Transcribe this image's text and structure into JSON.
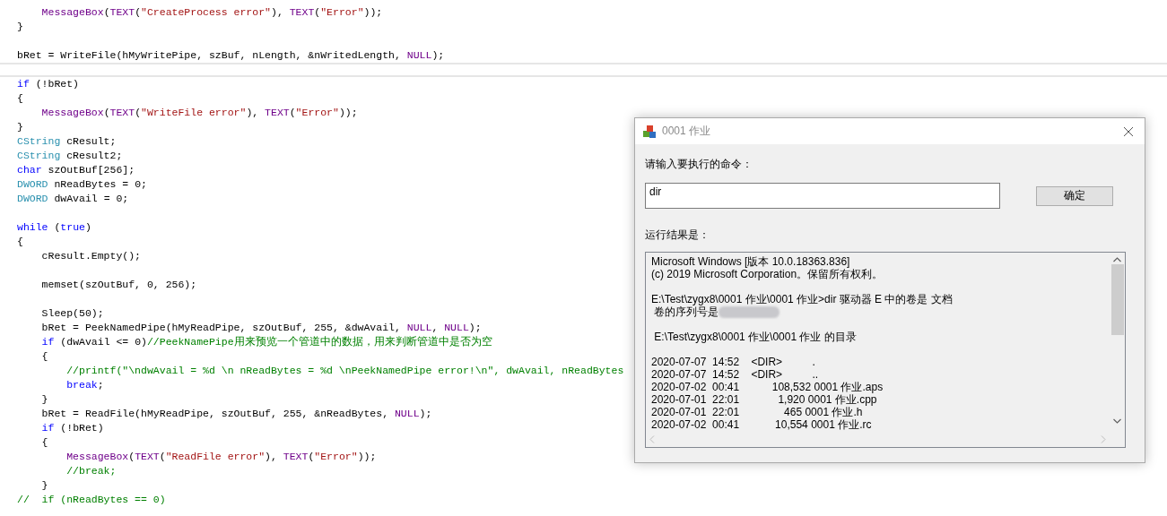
{
  "editor": {
    "lines": [
      {
        "current": false,
        "kind": "code",
        "tokens": [
          {
            "kind": "macro",
            "text": "    MessageBox"
          },
          {
            "kind": "plain",
            "text": "("
          },
          {
            "kind": "macro",
            "text": "TEXT"
          },
          {
            "kind": "plain",
            "text": "("
          },
          {
            "kind": "string",
            "text": "\"CreateProcess error\""
          },
          {
            "kind": "plain",
            "text": "), "
          },
          {
            "kind": "macro",
            "text": "TEXT"
          },
          {
            "kind": "plain",
            "text": "("
          },
          {
            "kind": "string",
            "text": "\"Error\""
          },
          {
            "kind": "plain",
            "text": "));"
          }
        ]
      },
      {
        "current": false,
        "kind": "code",
        "tokens": [
          {
            "kind": "plain",
            "text": "}"
          }
        ]
      },
      {
        "current": false,
        "kind": "blank"
      },
      {
        "current": false,
        "kind": "code",
        "tokens": [
          {
            "kind": "plain",
            "text": "bRet = WriteFile(hMyWritePipe, szBuf, nLength, &nWritedLength, "
          },
          {
            "kind": "macro",
            "text": "NULL"
          },
          {
            "kind": "plain",
            "text": ");"
          }
        ]
      },
      {
        "current": true,
        "kind": "blank"
      },
      {
        "current": false,
        "kind": "code",
        "tokens": [
          {
            "kind": "keyword",
            "text": "if"
          },
          {
            "kind": "plain",
            "text": " (!bRet)"
          }
        ]
      },
      {
        "current": false,
        "kind": "code",
        "tokens": [
          {
            "kind": "plain",
            "text": "{"
          }
        ]
      },
      {
        "current": false,
        "kind": "code",
        "tokens": [
          {
            "kind": "macro",
            "text": "    MessageBox"
          },
          {
            "kind": "plain",
            "text": "("
          },
          {
            "kind": "macro",
            "text": "TEXT"
          },
          {
            "kind": "plain",
            "text": "("
          },
          {
            "kind": "string",
            "text": "\"WriteFile error\""
          },
          {
            "kind": "plain",
            "text": "), "
          },
          {
            "kind": "macro",
            "text": "TEXT"
          },
          {
            "kind": "plain",
            "text": "("
          },
          {
            "kind": "string",
            "text": "\"Error\""
          },
          {
            "kind": "plain",
            "text": "));"
          }
        ]
      },
      {
        "current": false,
        "kind": "code",
        "tokens": [
          {
            "kind": "plain",
            "text": "}"
          }
        ]
      },
      {
        "current": false,
        "kind": "code",
        "tokens": [
          {
            "kind": "type",
            "text": "CString"
          },
          {
            "kind": "plain",
            "text": " cResult;"
          }
        ]
      },
      {
        "current": false,
        "kind": "code",
        "tokens": [
          {
            "kind": "type",
            "text": "CString"
          },
          {
            "kind": "plain",
            "text": " cResult2;"
          }
        ]
      },
      {
        "current": false,
        "kind": "code",
        "tokens": [
          {
            "kind": "keyword",
            "text": "char"
          },
          {
            "kind": "plain",
            "text": " szOutBuf[256];"
          }
        ]
      },
      {
        "current": false,
        "kind": "code",
        "tokens": [
          {
            "kind": "type",
            "text": "DWORD"
          },
          {
            "kind": "plain",
            "text": " nReadBytes = 0;"
          }
        ]
      },
      {
        "current": false,
        "kind": "code",
        "tokens": [
          {
            "kind": "type",
            "text": "DWORD"
          },
          {
            "kind": "plain",
            "text": " dwAvail = 0;"
          }
        ]
      },
      {
        "current": false,
        "kind": "blank"
      },
      {
        "current": false,
        "kind": "code",
        "tokens": [
          {
            "kind": "keyword",
            "text": "while"
          },
          {
            "kind": "plain",
            "text": " ("
          },
          {
            "kind": "keyword",
            "text": "true"
          },
          {
            "kind": "plain",
            "text": ")"
          }
        ]
      },
      {
        "current": false,
        "kind": "code",
        "tokens": [
          {
            "kind": "plain",
            "text": "{"
          }
        ]
      },
      {
        "current": false,
        "kind": "code",
        "tokens": [
          {
            "kind": "plain",
            "text": "    cResult.Empty();"
          }
        ]
      },
      {
        "current": false,
        "kind": "blank"
      },
      {
        "current": false,
        "kind": "code",
        "tokens": [
          {
            "kind": "plain",
            "text": "    memset(szOutBuf, 0, 256);"
          }
        ]
      },
      {
        "current": false,
        "kind": "blank"
      },
      {
        "current": false,
        "kind": "code",
        "tokens": [
          {
            "kind": "plain",
            "text": "    Sleep(50);"
          }
        ]
      },
      {
        "current": false,
        "kind": "code",
        "tokens": [
          {
            "kind": "plain",
            "text": "    bRet = PeekNamedPipe(hMyReadPipe, szOutBuf, 255, &dwAvail, "
          },
          {
            "kind": "macro",
            "text": "NULL"
          },
          {
            "kind": "plain",
            "text": ", "
          },
          {
            "kind": "macro",
            "text": "NULL"
          },
          {
            "kind": "plain",
            "text": ");"
          }
        ]
      },
      {
        "current": false,
        "kind": "code",
        "tokens": [
          {
            "kind": "keyword",
            "text": "    if"
          },
          {
            "kind": "plain",
            "text": " (dwAvail <= 0)"
          },
          {
            "kind": "comment",
            "text": "//PeekNamePipe用来预览一个管道中的数据，用来判断管道中是否为空"
          }
        ]
      },
      {
        "current": false,
        "kind": "code",
        "tokens": [
          {
            "kind": "plain",
            "text": "    {"
          }
        ]
      },
      {
        "current": false,
        "kind": "code",
        "tokens": [
          {
            "kind": "comment",
            "text": "        //printf(\"\\ndwAvail = %d \\n nReadBytes = %d \\nPeekNamedPipe error!\\n\", dwAvail, nReadBytes"
          }
        ]
      },
      {
        "current": false,
        "kind": "code",
        "tokens": [
          {
            "kind": "keyword",
            "text": "        break"
          },
          {
            "kind": "plain",
            "text": ";"
          }
        ]
      },
      {
        "current": false,
        "kind": "code",
        "tokens": [
          {
            "kind": "plain",
            "text": "    }"
          }
        ]
      },
      {
        "current": false,
        "kind": "code",
        "tokens": [
          {
            "kind": "plain",
            "text": "    bRet = ReadFile(hMyReadPipe, szOutBuf, 255, &nReadBytes, "
          },
          {
            "kind": "macro",
            "text": "NULL"
          },
          {
            "kind": "plain",
            "text": ");"
          }
        ]
      },
      {
        "current": false,
        "kind": "code",
        "tokens": [
          {
            "kind": "keyword",
            "text": "    if"
          },
          {
            "kind": "plain",
            "text": " (!bRet)"
          }
        ]
      },
      {
        "current": false,
        "kind": "code",
        "tokens": [
          {
            "kind": "plain",
            "text": "    {"
          }
        ]
      },
      {
        "current": false,
        "kind": "code",
        "tokens": [
          {
            "kind": "macro",
            "text": "        MessageBox"
          },
          {
            "kind": "plain",
            "text": "("
          },
          {
            "kind": "macro",
            "text": "TEXT"
          },
          {
            "kind": "plain",
            "text": "("
          },
          {
            "kind": "string",
            "text": "\"ReadFile error\""
          },
          {
            "kind": "plain",
            "text": "), "
          },
          {
            "kind": "macro",
            "text": "TEXT"
          },
          {
            "kind": "plain",
            "text": "("
          },
          {
            "kind": "string",
            "text": "\"Error\""
          },
          {
            "kind": "plain",
            "text": "));"
          }
        ]
      },
      {
        "current": false,
        "kind": "code",
        "tokens": [
          {
            "kind": "comment",
            "text": "        //break;"
          }
        ]
      },
      {
        "current": false,
        "kind": "code",
        "tokens": [
          {
            "kind": "plain",
            "text": "    }"
          }
        ]
      },
      {
        "current": false,
        "kind": "code",
        "tokens": [
          {
            "kind": "comment",
            "text": "//  if (nReadBytes == 0)"
          }
        ]
      }
    ]
  },
  "dialog": {
    "title": "0001 作业",
    "command_label": "请输入要执行的命令：",
    "command_input": {
      "value": "dir"
    },
    "ok_button": "确定",
    "result_label": "运行结果是：",
    "output_lines": [
      {
        "kind": "text",
        "text": "Microsoft Windows [版本 10.0.18363.836]"
      },
      {
        "kind": "text",
        "text": "(c) 2019 Microsoft Corporation。保留所有权利。"
      },
      {
        "kind": "blank"
      },
      {
        "kind": "text",
        "text": "E:\\Test\\zygx8\\0001 作业\\0001 作业>dir 驱动器 E 中的卷是 文档"
      },
      {
        "kind": "redacted",
        "text": " 卷的序列号是"
      },
      {
        "kind": "blank"
      },
      {
        "kind": "text",
        "text": " E:\\Test\\zygx8\\0001 作业\\0001 作业 的目录"
      },
      {
        "kind": "blank"
      },
      {
        "kind": "text",
        "text": "2020-07-07  14:52    <DIR>          ."
      },
      {
        "kind": "text",
        "text": "2020-07-07  14:52    <DIR>          .."
      },
      {
        "kind": "text",
        "text": "2020-07-02  00:41           108,532 0001 作业.aps"
      },
      {
        "kind": "text",
        "text": "2020-07-01  22:01             1,920 0001 作业.cpp"
      },
      {
        "kind": "text",
        "text": "2020-07-01  22:01               465 0001 作业.h"
      },
      {
        "kind": "text",
        "text": "2020-07-02  00:41            10,554 0001 作业.rc"
      }
    ]
  }
}
